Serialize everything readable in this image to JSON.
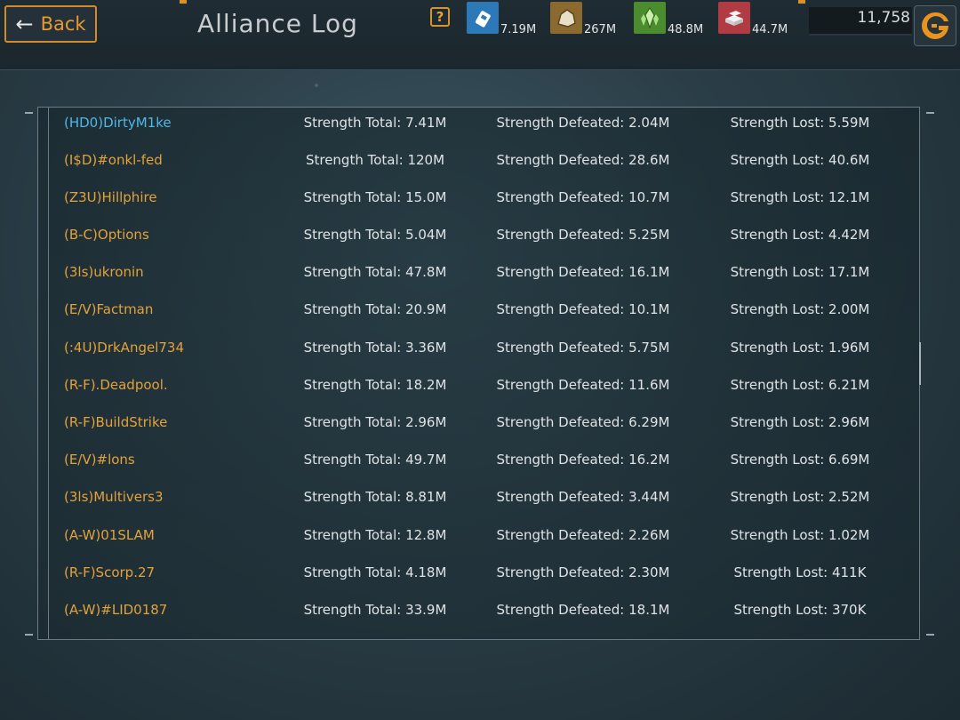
{
  "header": {
    "back_label": "Back",
    "title": "Alliance Log",
    "help_label": "?",
    "resources": [
      {
        "name": "fuel",
        "icon": "fuel-canister-icon",
        "color": "#2d79b7",
        "value": "7.19M"
      },
      {
        "name": "ore",
        "icon": "ore-rock-icon",
        "color": "#8a6a2e",
        "value": "267M"
      },
      {
        "name": "crystal",
        "icon": "crystal-icon",
        "color": "#4b8c2e",
        "value": "48.8M"
      },
      {
        "name": "metal",
        "icon": "metal-bars-icon",
        "color": "#b03b42",
        "value": "44.7M"
      }
    ],
    "gold": {
      "value": "11,758",
      "icon": "gold-coin-icon"
    }
  },
  "log": {
    "rows": [
      {
        "name": "(HD0)DirtyM1ke",
        "total": "Strength Total: 7.41M",
        "defeated": "Strength Defeated: 2.04M",
        "lost": "Strength Lost: 5.59M",
        "highlight": true
      },
      {
        "name": "(I$D)#onkl-fed",
        "total": "Strength Total: 120M",
        "defeated": "Strength Defeated: 28.6M",
        "lost": "Strength Lost: 40.6M"
      },
      {
        "name": "(Z3U)Hillphire",
        "total": "Strength Total: 15.0M",
        "defeated": "Strength Defeated: 10.7M",
        "lost": "Strength Lost: 12.1M"
      },
      {
        "name": "(B-C)Options",
        "total": "Strength Total: 5.04M",
        "defeated": "Strength Defeated: 5.25M",
        "lost": "Strength Lost: 4.42M"
      },
      {
        "name": "(3ls)ukronin",
        "total": "Strength Total: 47.8M",
        "defeated": "Strength Defeated: 16.1M",
        "lost": "Strength Lost: 17.1M"
      },
      {
        "name": "(E/V)Factman",
        "total": "Strength Total: 20.9M",
        "defeated": "Strength Defeated: 10.1M",
        "lost": "Strength Lost: 2.00M"
      },
      {
        "name": "(:4U)DrkAngel734",
        "total": "Strength Total: 3.36M",
        "defeated": "Strength Defeated: 5.75M",
        "lost": "Strength Lost: 1.96M"
      },
      {
        "name": "(R-F).Deadpool.",
        "total": "Strength Total: 18.2M",
        "defeated": "Strength Defeated: 11.6M",
        "lost": "Strength Lost: 6.21M"
      },
      {
        "name": "(R-F)BuildStrike",
        "total": "Strength Total: 2.96M",
        "defeated": "Strength Defeated: 6.29M",
        "lost": "Strength Lost: 2.96M"
      },
      {
        "name": "(E/V)#lons",
        "total": "Strength Total: 49.7M",
        "defeated": "Strength Defeated: 16.2M",
        "lost": "Strength Lost: 6.69M"
      },
      {
        "name": "(3ls)Multivers3",
        "total": "Strength Total: 8.81M",
        "defeated": "Strength Defeated: 3.44M",
        "lost": "Strength Lost: 2.52M"
      },
      {
        "name": "(A-W)01SLAM",
        "total": "Strength Total: 12.8M",
        "defeated": "Strength Defeated: 2.26M",
        "lost": "Strength Lost: 1.02M"
      },
      {
        "name": "(R-F)Scorp.27",
        "total": "Strength Total: 4.18M",
        "defeated": "Strength Defeated: 2.30M",
        "lost": "Strength Lost: 411K"
      },
      {
        "name": "(A-W)#LID0187",
        "total": "Strength Total: 33.9M",
        "defeated": "Strength Defeated: 18.1M",
        "lost": "Strength Lost: 370K"
      }
    ]
  },
  "colors": {
    "accent": "#d8942a",
    "name": "#e3a23a",
    "self_name": "#4fb8e8"
  }
}
